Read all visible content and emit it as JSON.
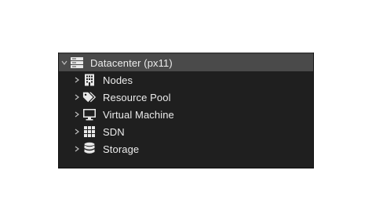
{
  "tree": {
    "root": {
      "label": "Datacenter (px11)",
      "icon": "server-stack-icon",
      "expanded": true
    },
    "children": [
      {
        "label": "Nodes",
        "icon": "building-icon"
      },
      {
        "label": "Resource Pool",
        "icon": "tags-icon"
      },
      {
        "label": "Virtual Machine",
        "icon": "monitor-icon"
      },
      {
        "label": "SDN",
        "icon": "grid-icon"
      },
      {
        "label": "Storage",
        "icon": "database-icon"
      }
    ]
  },
  "colors": {
    "panel_bg": "#1f1f1f",
    "selected_bg": "#4a4a4a",
    "text": "#ececec",
    "icon": "#e8e8e8"
  }
}
